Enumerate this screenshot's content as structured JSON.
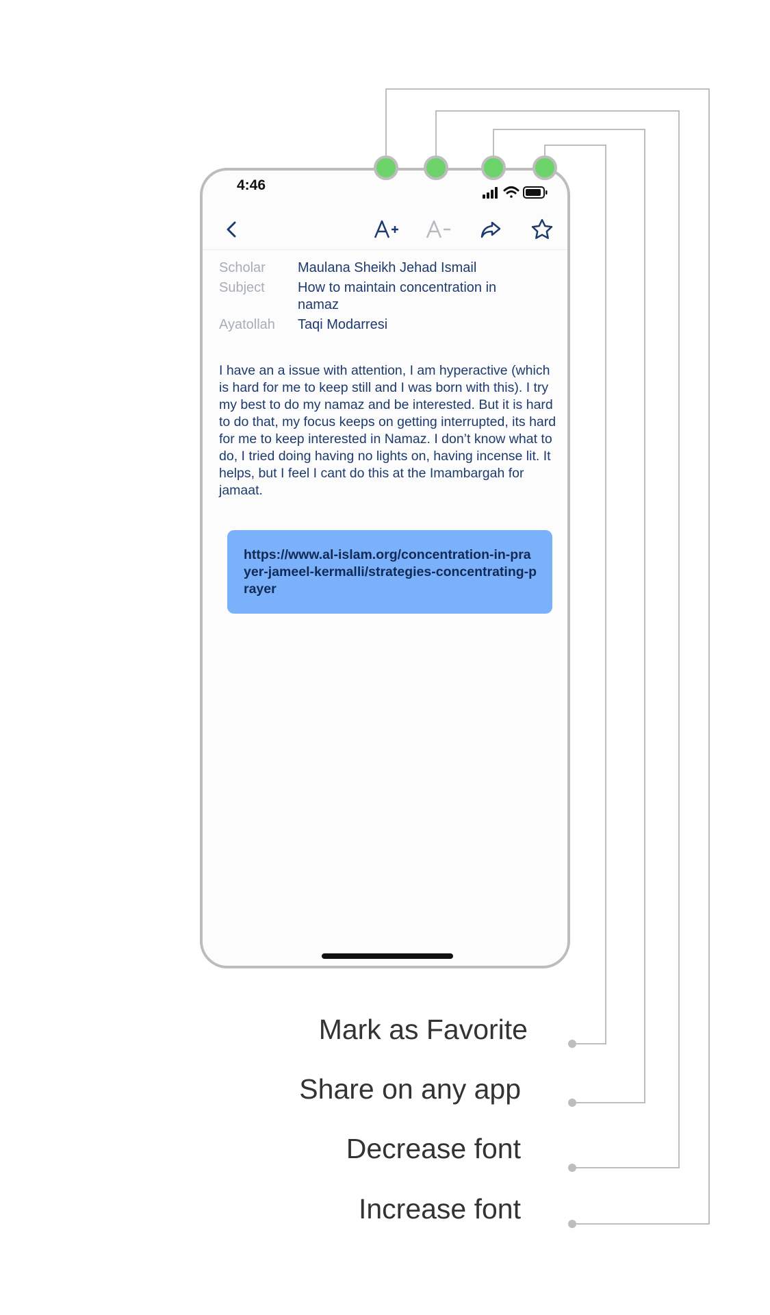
{
  "status_bar": {
    "time": "4:46",
    "icons": [
      "signal-icon",
      "wifi-icon",
      "battery-icon"
    ]
  },
  "toolbar": {
    "back_icon": "chevron-left-icon",
    "increase_font_label": "A+",
    "decrease_font_label": "A−",
    "share_icon": "share-arrow-icon",
    "favorite_icon": "star-icon"
  },
  "details": {
    "scholar_label": "Scholar",
    "scholar_value": "Maulana Sheikh Jehad Ismail",
    "subject_label": "Subject",
    "subject_value": "How to maintain concentration in namaz",
    "ayatollah_label": "Ayatollah",
    "ayatollah_value": "Taqi Modarresi"
  },
  "question_text": "I have an a issue with attention, I am hyperactive (which is hard for me to keep still and I was born with this). I try my best to do my namaz and be interested. But it is hard to do that, my focus keeps on getting interrupted, its hard for me to keep interested in Namaz. I don’t know what to do, I tried doing having no lights on, having incense lit. It helps, but I feel I cant do this at the Imambargah for jamaat.",
  "answer_link": "https://www.al-islam.org/concentration-in-prayer-jameel-kermalli/strategies-concentrating-prayer",
  "annotations": {
    "favorite": "Mark as Favorite",
    "share": "Share on any app",
    "decrease_font": "Decrease font",
    "increase_font": "Increase font"
  },
  "colors": {
    "accent_text": "#1d3a6e",
    "label_text": "#a8adb5",
    "link_card": "#7bb1fb",
    "marker_green": "#6cd36a",
    "connector_gray": "#bdbdbd"
  }
}
